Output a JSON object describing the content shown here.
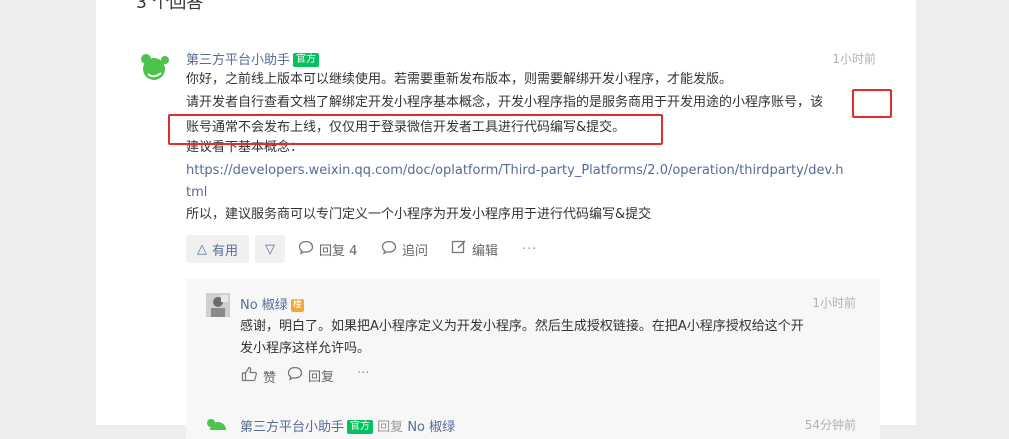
{
  "header": {
    "answer_count": "3 个回答"
  },
  "answer": {
    "author": "第三方平台小助手",
    "badge": "官方",
    "time": "1小时前",
    "lines": [
      "你好，之前线上版本可以继续使用。若需要重新发布版本，则需要解绑开发小程序，才能发版。",
      "请开发者自行查看文档了解绑定开发小程序基本概念，开发小程序指的是服务商用于开发用途的小程序账号，该",
      "账号通常不会发布上线，仅仅用于登录微信开发者工具进行代码编写&提交。",
      "建议看下基本概念："
    ],
    "link_line1": "https://developers.weixin.qq.com/doc/oplatform/Third-party_Platforms/2.0/operation/thirdparty/dev.h",
    "link_line2": "tml",
    "last_line": "所以，建议服务商可以专门定义一个小程序为开发小程序用于进行代码编写&提交",
    "actions": {
      "useful": "有用",
      "reply": "回复 4",
      "share": "追问",
      "edit": "编辑",
      "more": "···"
    }
  },
  "reply1": {
    "author": "No 椒绿",
    "badge": "楼",
    "time": "1小时前",
    "lines": [
      "感谢，明白了。如果把A小程序定义为开发小程序。然后生成授权链接。在把A小程序授权给这个开",
      "发小程序这样允许吗。"
    ],
    "actions": {
      "like": "赞",
      "reply": "回复",
      "more": "···"
    }
  },
  "reply2": {
    "author": "第三方平台小助手",
    "badge": "官方",
    "reply_word": "回复",
    "reply_to": "No 椒绿",
    "time": "54分钟前"
  },
  "icons": {
    "brand_green": "#4bc44b",
    "link_color": "#576b95",
    "highlight_red": "#e02c2c"
  }
}
